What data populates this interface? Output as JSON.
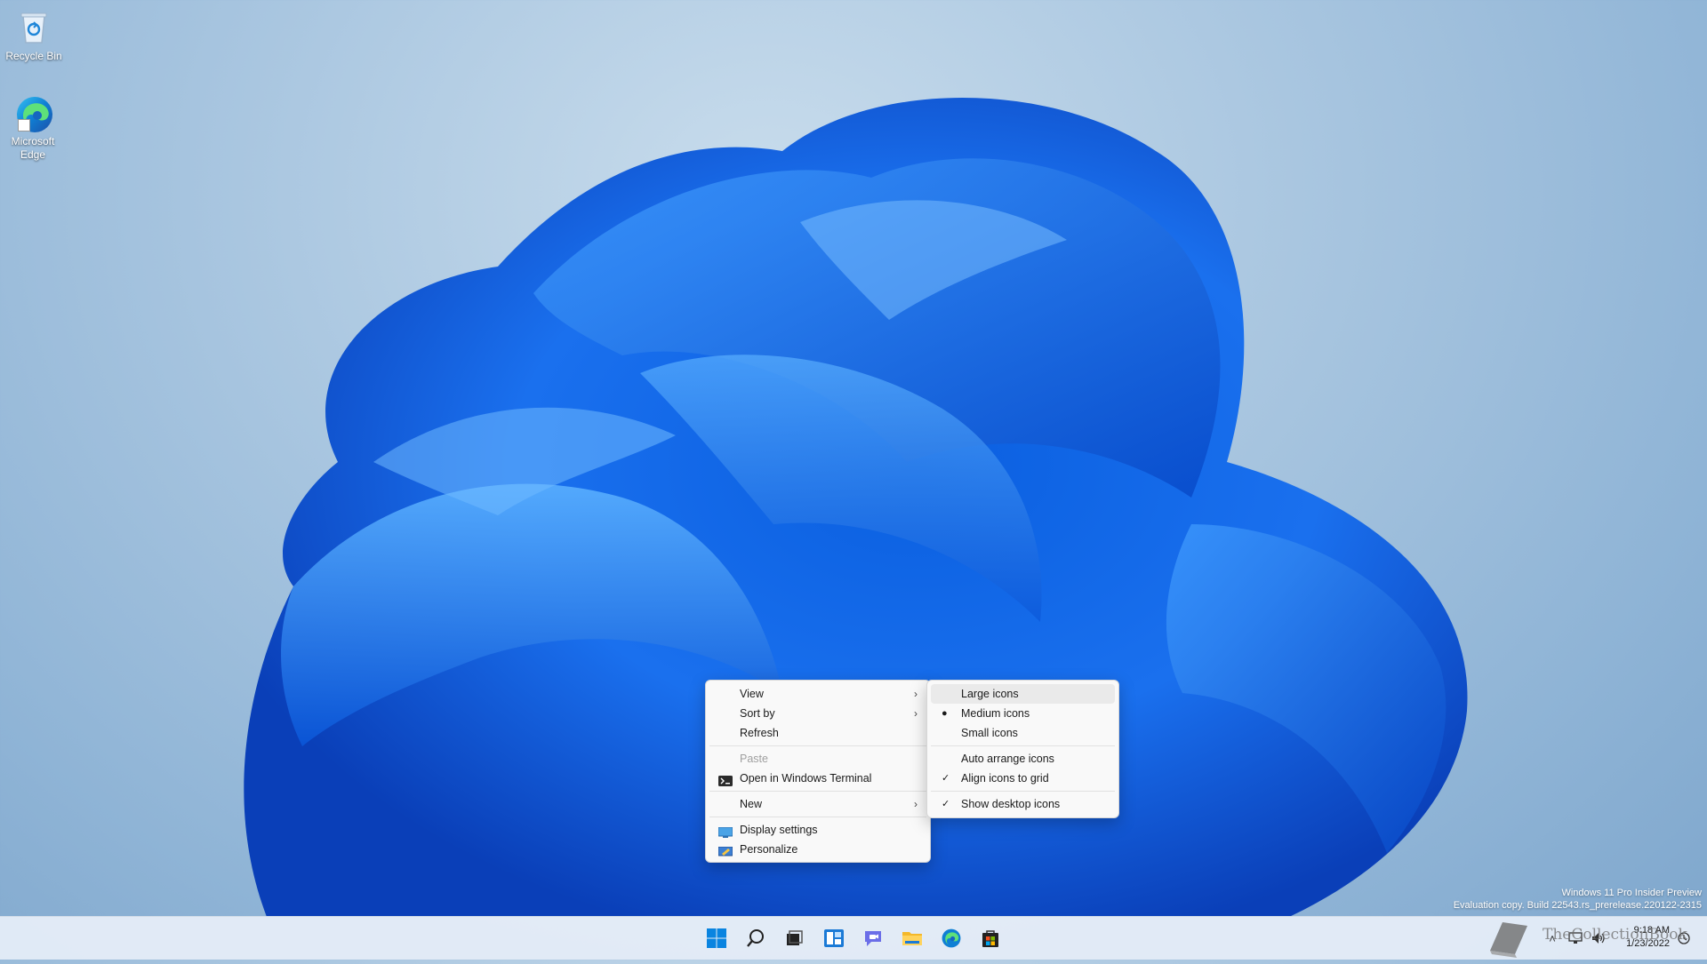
{
  "desktop": {
    "icons": [
      {
        "label": "Recycle Bin"
      },
      {
        "label": "Microsoft Edge"
      }
    ]
  },
  "context_menu": {
    "items": [
      {
        "label": "View"
      },
      {
        "label": "Sort by"
      },
      {
        "label": "Refresh"
      },
      {
        "label": "Paste"
      },
      {
        "label": "Open in Windows Terminal"
      },
      {
        "label": "New"
      },
      {
        "label": "Display settings"
      },
      {
        "label": "Personalize"
      }
    ]
  },
  "view_submenu": {
    "items": [
      {
        "label": "Large icons"
      },
      {
        "label": "Medium icons"
      },
      {
        "label": "Small icons"
      },
      {
        "label": "Auto arrange icons"
      },
      {
        "label": "Align icons to grid"
      },
      {
        "label": "Show desktop icons"
      }
    ]
  },
  "watermark": {
    "line1": "Windows 11 Pro Insider Preview",
    "line2": "Evaluation copy. Build 22543.rs_prerelease.220122-2315"
  },
  "taskbar": {
    "time": "9:18 AM",
    "date": "1/23/2022"
  },
  "overlay": {
    "brand": "TheCollectionBook"
  },
  "colors": {
    "accent": "#0067c0",
    "menu_bg": "#f9f9f9",
    "taskbar_bg": "#e8eff8"
  }
}
